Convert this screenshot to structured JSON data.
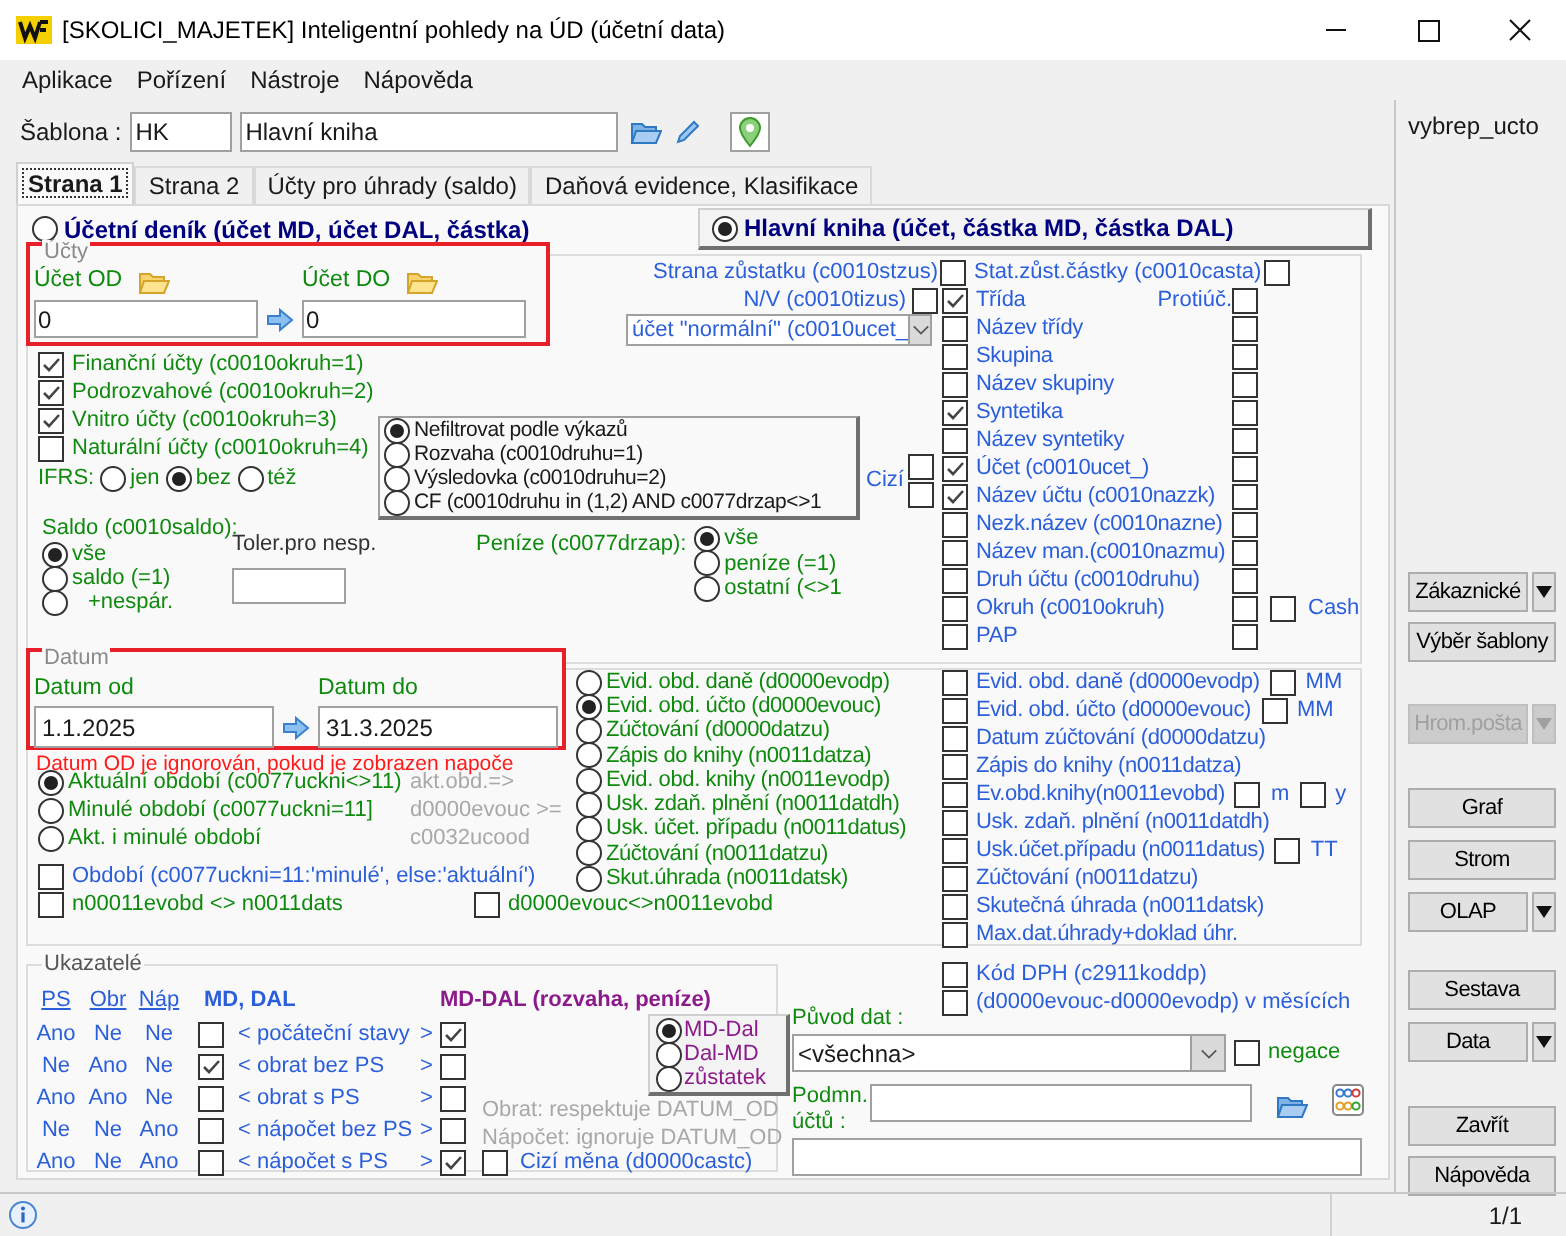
{
  "window": {
    "title": "[SKOLICI_MAJETEK] Inteligentní pohledy na ÚD (účetní data)"
  },
  "menu": [
    "Aplikace",
    "Pořízení",
    "Nástroje",
    "Nápověda"
  ],
  "template": {
    "label": "Šablona :",
    "code": "HK",
    "name": "Hlavní kniha"
  },
  "side_label": "vybrep_ucto",
  "tabs": [
    {
      "label": "Strana 1",
      "selected": true
    },
    {
      "label": "Strana 2",
      "selected": false
    },
    {
      "label": "Účty pro úhrady (saldo)",
      "selected": false
    },
    {
      "label": "Daňová evidence, Klasifikace",
      "selected": false
    }
  ],
  "mode": [
    {
      "label": "Účetní deník (účet MD, účet DAL, částka)",
      "selected": false
    },
    {
      "label": "Hlavní kniha (účet, částka MD, částka DAL)",
      "selected": true
    }
  ],
  "accounts": {
    "title": "Účty",
    "from_label": "Účet OD",
    "from": "0",
    "to_label": "Účet DO",
    "to": "0"
  },
  "account_ranges": [
    {
      "label": "Finanční účty (c0010okruh=1)",
      "checked": true
    },
    {
      "label": "Podrozvahové (c0010okruh=2)",
      "checked": true
    },
    {
      "label": "Vnitro účty (c0010okruh=3)",
      "checked": true
    },
    {
      "label": "Naturální účty (c0010okruh=4)",
      "checked": false
    }
  ],
  "ifrs": {
    "label": "IFRS:",
    "options": [
      {
        "label": "jen",
        "selected": false
      },
      {
        "label": "bez",
        "selected": true
      },
      {
        "label": "též",
        "selected": false
      }
    ]
  },
  "report_filter": [
    {
      "label": "Nefiltrovat podle výkazů",
      "selected": true
    },
    {
      "label": "Rozvaha (c0010druhu=1)",
      "selected": false
    },
    {
      "label": "Výsledovka (c0010druhu=2)",
      "selected": false
    },
    {
      "label": "CF (c0010druhu in (1,2) AND c0077drzap<>1",
      "selected": false
    }
  ],
  "saldo": {
    "label": "Saldo (c0010saldo):",
    "options": [
      {
        "label": "vše",
        "selected": true
      },
      {
        "label": "saldo (=1)",
        "selected": false
      },
      {
        "label": "+nespár.",
        "selected": false
      }
    ]
  },
  "tolerance": {
    "label": "Toler.pro nesp."
  },
  "money": {
    "label": "Peníze (c0077drzap):",
    "options": [
      {
        "label": "vše",
        "selected": true
      },
      {
        "label": "peníze (=1)",
        "selected": false
      },
      {
        "label": "ostatní (<>1",
        "selected": false
      }
    ]
  },
  "balance_side": {
    "label": "Strana zůstatku (c0010stzus)",
    "checked": false
  },
  "nv": {
    "label": "N/V (c0010tizus)",
    "checked": false
  },
  "account_type": {
    "value": "účet \"normální\" (c0010ucet_"
  },
  "stat_balance": {
    "label": "Stat.zůst.částky (c0010casta)",
    "checked": false
  },
  "counter_label": "Protiúč.",
  "foreign": {
    "label": "Cizí",
    "checks": [
      {
        "checked": false
      },
      {
        "checked": false
      }
    ]
  },
  "columns": [
    {
      "label": "Třída",
      "checked": true,
      "counter": false
    },
    {
      "label": "Název třídy",
      "checked": false,
      "counter": false
    },
    {
      "label": "Skupina",
      "checked": false,
      "counter": false
    },
    {
      "label": "Název skupiny",
      "checked": false,
      "counter": false
    },
    {
      "label": "Syntetika",
      "checked": true,
      "counter": false
    },
    {
      "label": "Název syntetiky",
      "checked": false,
      "counter": false
    },
    {
      "label": "Účet (c0010ucet_)",
      "checked": true,
      "counter": false
    },
    {
      "label": "Název účtu (c0010nazzk)",
      "checked": true,
      "counter": false
    },
    {
      "label": "Nezk.název (c0010nazne)",
      "checked": false,
      "counter": false
    },
    {
      "label": "Název man.(c0010nazmu)",
      "checked": false,
      "counter": false
    },
    {
      "label": "Druh účtu (c0010druhu)",
      "checked": false,
      "counter": false
    },
    {
      "label": "Okruh (c0010okruh)",
      "checked": false,
      "counter": false,
      "extra": [
        {
          "label": "Cash",
          "checked": false
        }
      ]
    },
    {
      "label": "PAP",
      "checked": false,
      "counter": false
    }
  ],
  "dates": {
    "title": "Datum",
    "from_label": "Datum od",
    "from": "1.1.2025",
    "to_label": "Datum do",
    "to": "31.3.2025",
    "warning": "Datum OD je ignorován, pokud je zobrazen napoče"
  },
  "periods": [
    {
      "label": "Aktuální období (c0077uckni<>11)",
      "selected": true
    },
    {
      "label": "Minulé období (c0077uckni=11]",
      "selected": false
    },
    {
      "label": "Akt. i minulé období",
      "selected": false
    }
  ],
  "period_note": [
    "akt.obd.=>",
    "d0000evouc >=",
    "c0032ucood"
  ],
  "date_fields": [
    {
      "label": "Evid. obd. daně (d0000evodp)",
      "selected": false
    },
    {
      "label": "Evid. obd. účto (d0000evouc)",
      "selected": true
    },
    {
      "label": "Zúčtování (d0000datzu)",
      "selected": false
    },
    {
      "label": "Zápis do knihy (n0011datza)",
      "selected": false
    },
    {
      "label": "Evid. obd. knihy (n0011evodp)",
      "selected": false
    },
    {
      "label": "Usk. zdaň. plnění (n0011datdh)",
      "selected": false
    },
    {
      "label": "Usk. účet. případu (n0011datus)",
      "selected": false
    },
    {
      "label": "Zúčtování (n0011datzu)",
      "selected": false
    },
    {
      "label": "Skut.úhrada (n0011datsk)",
      "selected": false
    }
  ],
  "date_columns": [
    {
      "label": "Evid. obd. daně (d0000evodp)",
      "checked": false,
      "extra": [
        {
          "label": "MM",
          "checked": false
        }
      ]
    },
    {
      "label": "Evid. obd. účto (d0000evouc)",
      "checked": false,
      "extra": [
        {
          "label": "MM",
          "checked": false
        }
      ]
    },
    {
      "label": "Datum zúčtování (d0000datzu)",
      "checked": false
    },
    {
      "label": "Zápis do knihy (n0011datza)",
      "checked": false
    },
    {
      "label": "Ev.obd.knihy(n0011evobd)",
      "checked": false,
      "extra": [
        {
          "label": "m",
          "checked": false
        },
        {
          "label": "y",
          "checked": false
        }
      ]
    },
    {
      "label": "Usk. zdaň. plnění (n0011datdh)",
      "checked": false
    },
    {
      "label": "Usk.účet.případu (n0011datus)",
      "checked": false,
      "extra": [
        {
          "label": "TT",
          "checked": false
        }
      ]
    },
    {
      "label": "Zúčtování (n0011datzu)",
      "checked": false
    },
    {
      "label": "Skutečná úhrada (n0011datsk)",
      "checked": false
    },
    {
      "label": "Max.dat.úhrady+doklad úhr.",
      "checked": false
    }
  ],
  "period_checks": [
    {
      "label": "Období (c0077uckni=11:'minulé', else:'aktuální')",
      "checked": false
    },
    {
      "label": "n00011evobd <> n0011dats",
      "checked": false
    },
    {
      "label": "d0000evouc<>n0011evobd",
      "checked": false
    }
  ],
  "vat_checks": [
    {
      "label": "Kód DPH (c2911koddp)",
      "checked": false
    },
    {
      "label": "(d0000evouc-d0000evodp) v měsících",
      "checked": false
    }
  ],
  "indicators": {
    "title": "Ukazatelé",
    "headers": [
      "PS",
      "Obr",
      "Náp"
    ],
    "md_dal_header": "MD, DAL",
    "diff_header": "MD-DAL (rozvaha, peníze)",
    "rows": [
      {
        "ps": "Ano",
        "obr": "Ne",
        "nap": "Ne",
        "md_dal": false,
        "label": "< počáteční stavy",
        "close": ">",
        "diff": true
      },
      {
        "ps": "Ne",
        "obr": "Ano",
        "nap": "Ne",
        "md_dal": true,
        "label": "< obrat bez PS",
        "close": ">",
        "diff": false
      },
      {
        "ps": "Ano",
        "obr": "Ano",
        "nap": "Ne",
        "md_dal": false,
        "label": "< obrat s PS",
        "close": ">",
        "diff": false
      },
      {
        "ps": "Ne",
        "obr": "Ne",
        "nap": "Ano",
        "md_dal": false,
        "label": "< nápočet bez PS",
        "close": ">",
        "diff": false
      },
      {
        "ps": "Ano",
        "obr": "Ne",
        "nap": "Ano",
        "md_dal": false,
        "label": "< nápočet s PS",
        "close": ">",
        "diff": true
      }
    ],
    "sign": [
      {
        "label": "MD-Dal",
        "selected": true
      },
      {
        "label": "Dal-MD",
        "selected": false
      },
      {
        "label": "zůstatek",
        "selected": false
      }
    ],
    "notes": [
      "Obrat: respektuje DATUM_OD",
      "Nápočet: ignoruje DATUM_OD"
    ],
    "foreign_currency": {
      "label": "Cizí měna (d0000castc)",
      "checked": false
    }
  },
  "origin": {
    "label": "Původ dat :",
    "value": "<všechna>",
    "negation": {
      "label": "negace",
      "checked": false
    }
  },
  "condition": {
    "label": "Podmn. účtů :"
  },
  "buttons": [
    {
      "label": "Zákaznické",
      "kind": "split",
      "disabled": false
    },
    {
      "label": "Výběr šablony",
      "kind": "plain",
      "disabled": false
    },
    {
      "label": "Hrom.pošta",
      "kind": "split",
      "disabled": true
    },
    {
      "label": "Graf",
      "kind": "plain",
      "disabled": false
    },
    {
      "label": "Strom",
      "kind": "plain",
      "disabled": false
    },
    {
      "label": "OLAP",
      "kind": "split",
      "disabled": false
    },
    {
      "label": "Sestava",
      "kind": "plain",
      "disabled": false
    },
    {
      "label": "Data",
      "kind": "split",
      "disabled": false
    },
    {
      "label": "Zavřít",
      "kind": "plain",
      "disabled": false
    },
    {
      "label": "Nápověda",
      "kind": "plain",
      "disabled": false
    }
  ],
  "status": {
    "page": "1/1"
  }
}
